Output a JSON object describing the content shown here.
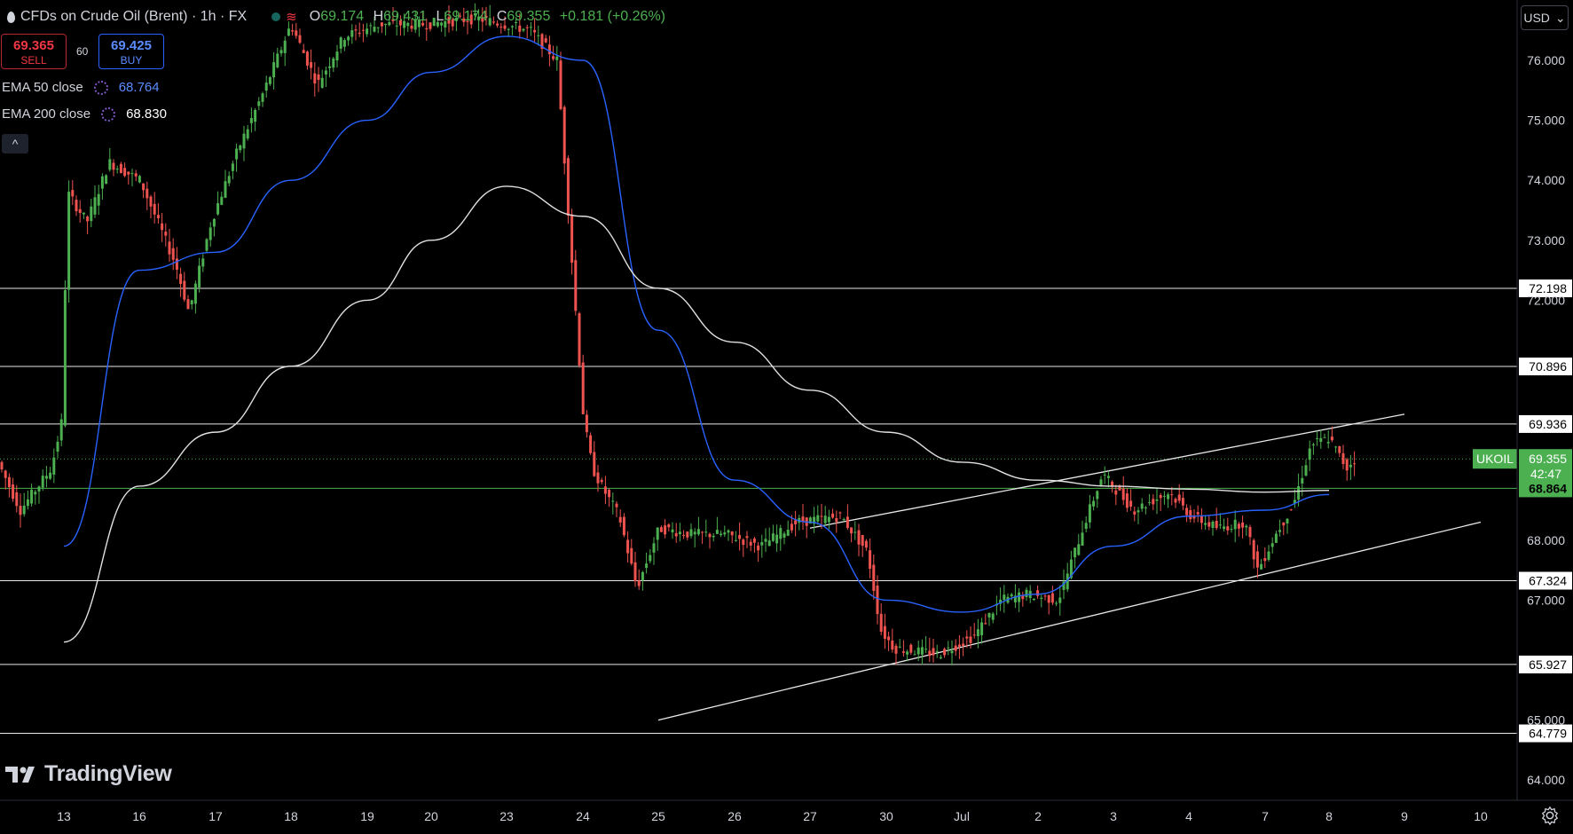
{
  "symbol": {
    "title": "CFDs on Crude Oil (Brent) · 1h · FX",
    "ohlc": {
      "o_key": "O",
      "o": "69.174",
      "h_key": "H",
      "h": "69.431",
      "l_key": "L",
      "l": "69.174",
      "c_key": "C",
      "c": "69.355",
      "change": "+0.181 (+0.26%)"
    }
  },
  "trade": {
    "sell_price": "69.365",
    "sell_label": "SELL",
    "spread": "60",
    "buy_price": "69.425",
    "buy_label": "BUY"
  },
  "indicators": [
    {
      "label": "EMA 50 close",
      "value": "68.764",
      "color": "#2962ff"
    },
    {
      "label": "EMA 200 close",
      "value": "68.830",
      "color": "#ffffff"
    }
  ],
  "collapse_label": "^",
  "currency": {
    "label": "USD",
    "arrow": "⌄"
  },
  "brand": "TradingView",
  "colors": {
    "up": "#4caf50",
    "down": "#ef5350",
    "ema50": "#2962ff",
    "ema200": "#e0e0e0",
    "background": "#000000",
    "price_tag": "#4caf50"
  },
  "chart_data": {
    "type": "line",
    "x_tick_labels": [
      "13",
      "16",
      "17",
      "18",
      "19",
      "20",
      "23",
      "24",
      "25",
      "26",
      "27",
      "30",
      "Jul",
      "2",
      "3",
      "4",
      "7",
      "8",
      "9",
      "10"
    ],
    "y_tick_labels": [
      "76.000",
      "75.000",
      "74.000",
      "73.000",
      "72.000",
      "67.000",
      "68.000",
      "65.000",
      "64.000"
    ],
    "ylim": [
      63.55,
      76.55
    ],
    "price_label": {
      "ticker": "UKOIL",
      "value": "69.355",
      "countdown": "42:47"
    },
    "horizontal_levels": [
      72.198,
      70.896,
      69.936,
      67.324,
      65.927,
      64.779
    ],
    "horizontal_level_labels": [
      "72.198",
      "70.896",
      "69.936",
      "67.324",
      "65.927",
      "64.779"
    ],
    "ema200_label": "68.864",
    "trendlines": [
      {
        "name": "lower channel",
        "from": [
          "25",
          65.0
        ],
        "to": [
          "10",
          68.3
        ]
      },
      {
        "name": "upper channel",
        "from": [
          "27",
          68.2
        ],
        "to": [
          "9",
          70.1
        ]
      }
    ],
    "series": [
      {
        "name": "EMA 50 close",
        "x": [
          "13",
          "16",
          "17",
          "18",
          "19",
          "20",
          "23",
          "24",
          "25",
          "26",
          "27",
          "30",
          "Jul",
          "2",
          "3",
          "4",
          "7",
          "8"
        ],
        "y": [
          67.9,
          72.5,
          72.8,
          74.0,
          75.0,
          75.8,
          76.4,
          76.0,
          71.5,
          69.0,
          68.3,
          67.0,
          66.8,
          67.1,
          67.9,
          68.4,
          68.5,
          68.76
        ]
      },
      {
        "name": "EMA 200 close",
        "x": [
          "13",
          "16",
          "17",
          "18",
          "19",
          "20",
          "23",
          "24",
          "25",
          "26",
          "27",
          "30",
          "Jul",
          "2",
          "3",
          "4",
          "7",
          "8"
        ],
        "y": [
          66.3,
          68.9,
          69.8,
          70.9,
          72.0,
          73.0,
          73.9,
          73.4,
          72.2,
          71.3,
          70.5,
          69.8,
          69.3,
          69.0,
          68.9,
          68.85,
          68.8,
          68.83
        ]
      }
    ]
  }
}
